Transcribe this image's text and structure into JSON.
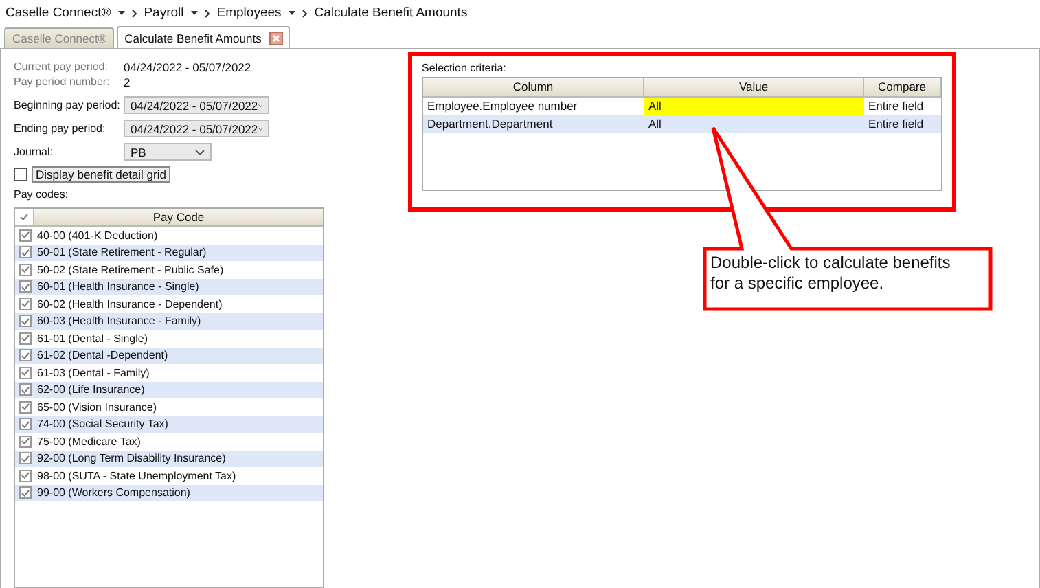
{
  "breadcrumb": [
    {
      "label": "Caselle Connect®",
      "dropdown": true
    },
    {
      "label": "Payroll",
      "dropdown": true
    },
    {
      "label": "Employees",
      "dropdown": true
    },
    {
      "label": "Calculate Benefit Amounts",
      "dropdown": false
    }
  ],
  "tabs": [
    {
      "label": "Caselle Connect®",
      "selected": false,
      "closable": false
    },
    {
      "label": "Calculate Benefit Amounts",
      "selected": true,
      "closable": true
    }
  ],
  "info": [
    {
      "label": "Current pay period:",
      "value": "04/24/2022 - 05/07/2022"
    },
    {
      "label": "Pay period number:",
      "value": "2"
    }
  ],
  "selects": [
    {
      "label": "Beginning pay period:",
      "value": "04/24/2022 - 05/07/2022",
      "wide": true
    },
    {
      "label": "Ending pay period:",
      "value": "04/24/2022 - 05/07/2022",
      "wide": true
    },
    {
      "label": "Journal:",
      "value": "PB",
      "wide": false
    }
  ],
  "detail_checkbox": {
    "label": "Display benefit detail grid",
    "checked": false
  },
  "pay_codes": {
    "label": "Pay codes:",
    "header": "Pay Code",
    "all_checked": true,
    "rows": [
      {
        "label": "40-00 (401-K Deduction)",
        "checked": true
      },
      {
        "label": "50-01 (State Retirement - Regular)",
        "checked": true
      },
      {
        "label": "50-02 (State Retirement - Public Safe)",
        "checked": true
      },
      {
        "label": "60-01 (Health Insurance - Single)",
        "checked": true
      },
      {
        "label": "60-02 (Health Insurance - Dependent)",
        "checked": true
      },
      {
        "label": "60-03 (Health Insurance - Family)",
        "checked": true
      },
      {
        "label": "61-01 (Dental - Single)",
        "checked": true
      },
      {
        "label": "61-02 (Dental -Dependent)",
        "checked": true
      },
      {
        "label": "61-03 (Dental - Family)",
        "checked": true
      },
      {
        "label": "62-00 (Life Insurance)",
        "checked": true
      },
      {
        "label": "65-00 (Vision Insurance)",
        "checked": true
      },
      {
        "label": "74-00 (Social Security Tax)",
        "checked": true
      },
      {
        "label": "75-00 (Medicare Tax)",
        "checked": true
      },
      {
        "label": "92-00 (Long Term Disability Insurance)",
        "checked": true
      },
      {
        "label": "98-00 (SUTA - State Unemployment Tax)",
        "checked": true
      },
      {
        "label": "99-00 (Workers Compensation)",
        "checked": true
      }
    ]
  },
  "selection_criteria": {
    "label": "Selection criteria:",
    "columns": [
      "Column",
      "Value",
      "Compare"
    ],
    "rows": [
      {
        "column": "Employee.Employee number",
        "value": "All",
        "compare": "Entire field",
        "highlighted": true
      },
      {
        "column": "Department.Department",
        "value": "All",
        "compare": "Entire field",
        "highlighted": false
      }
    ]
  },
  "callout": {
    "text": "Double-click to calculate benefits for a specific employee."
  }
}
